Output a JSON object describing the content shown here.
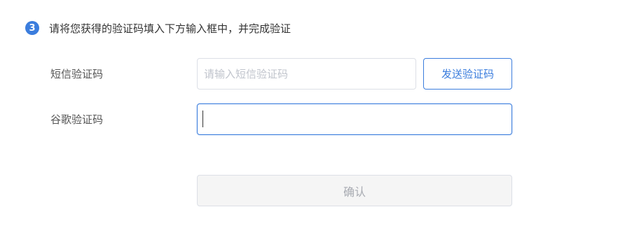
{
  "step": {
    "number": "3",
    "instruction": "请将您获得的验证码填入下方输入框中，并完成验证"
  },
  "sms": {
    "label": "短信验证码",
    "placeholder": "请输入短信验证码",
    "value": "",
    "send_label": "发送验证码"
  },
  "google": {
    "label": "谷歌验证码",
    "value": ""
  },
  "confirm": {
    "label": "确认"
  },
  "colors": {
    "accent": "#3b7ddd",
    "disabled_bg": "#f5f5f5",
    "disabled_text": "#a8abb2",
    "border": "#dcdfe6"
  }
}
